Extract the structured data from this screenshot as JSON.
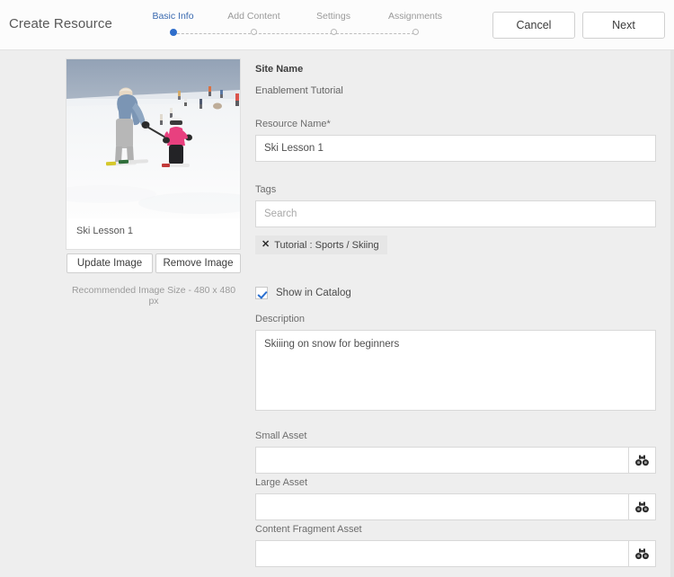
{
  "header": {
    "title": "Create Resource",
    "cancel_label": "Cancel",
    "next_label": "Next",
    "active_accent_color": "#2f6ecb",
    "steps": [
      {
        "label": "Basic Info",
        "active": true
      },
      {
        "label": "Add Content",
        "active": false
      },
      {
        "label": "Settings",
        "active": false
      },
      {
        "label": "Assignments",
        "active": false
      }
    ]
  },
  "image_panel": {
    "caption": "Ski Lesson 1",
    "update_label": "Update Image",
    "remove_label": "Remove Image",
    "recommended_note": "Recommended Image Size - 480 x 480 px",
    "thumbnail_alt": "ski-lesson-photo"
  },
  "form": {
    "site_name_heading": "Site Name",
    "site_name_value": "Enablement Tutorial",
    "resource_name_label": "Resource Name*",
    "resource_name_value": "Ski Lesson 1",
    "tags_label": "Tags",
    "tags_placeholder": "Search",
    "tags_value": "",
    "tag_chip": {
      "remove_icon": "✕",
      "text": "Tutorial : Sports / Skiing"
    },
    "show_in_catalog_label": "Show in Catalog",
    "show_in_catalog_checked": true,
    "description_label": "Description",
    "description_value": "Skiiing on snow for beginners",
    "assets": [
      {
        "label": "Small Asset",
        "value": "",
        "browse_icon": "binoculars-icon"
      },
      {
        "label": "Large Asset",
        "value": "",
        "browse_icon": "binoculars-icon"
      },
      {
        "label": "Content Fragment Asset",
        "value": "",
        "browse_icon": "binoculars-icon"
      }
    ]
  }
}
